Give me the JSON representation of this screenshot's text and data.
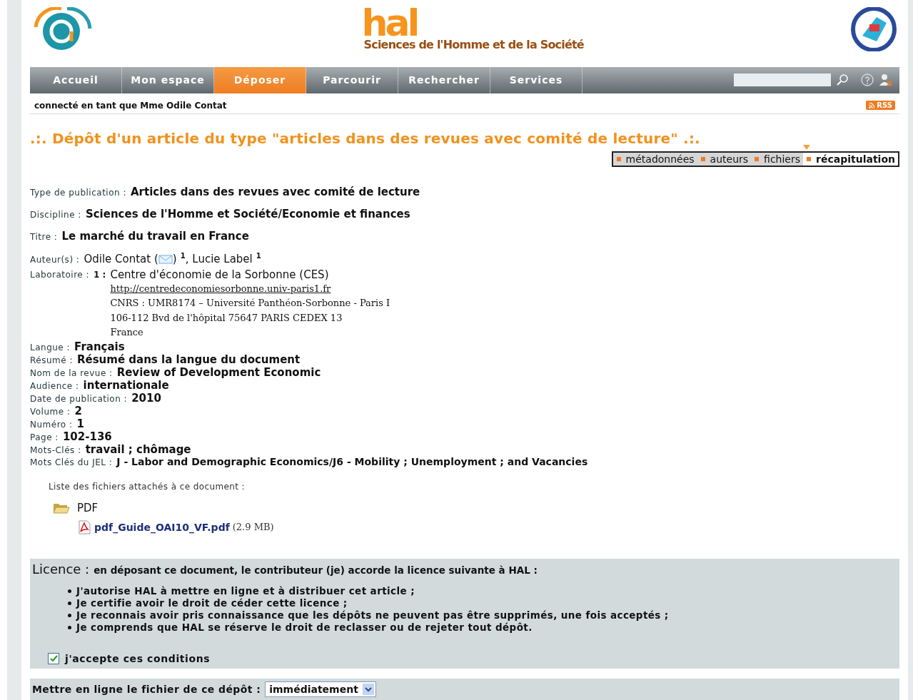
{
  "header": {
    "logo_word": "hal",
    "subtitle": "Sciences de l'Homme et de la Société"
  },
  "nav": {
    "items": [
      {
        "label": "Accueil",
        "selected": false
      },
      {
        "label": "Mon espace",
        "selected": false
      },
      {
        "label": "Déposer",
        "selected": true
      },
      {
        "label": "Parcourir",
        "selected": false
      },
      {
        "label": "Rechercher",
        "selected": false
      },
      {
        "label": "Services",
        "selected": false
      }
    ]
  },
  "login": "connecté en tant que Mme Odile Contat",
  "rss": "RSS",
  "title": ".:. Dépôt d'un article du type \"articles dans des revues avec comité de lecture\" .:.",
  "steps": [
    {
      "label": "métadonnées",
      "selected": false
    },
    {
      "label": "auteurs",
      "selected": false
    },
    {
      "label": "fichiers",
      "selected": false
    },
    {
      "label": "récapitulation",
      "selected": true
    }
  ],
  "main_fields": [
    {
      "label": "Type de publication :",
      "value": "Articles dans des revues avec comité de lecture"
    },
    {
      "label": "Discipline :",
      "value": "Sciences de l'Homme et Société/Economie et finances"
    },
    {
      "label": "Titre :",
      "value": "Le marché du travail en France"
    }
  ],
  "authors": {
    "label": "Auteur(s) :",
    "items": [
      {
        "text": "Odile Contat (",
        "email": true,
        "after": ")",
        "affiliation": "1"
      },
      {
        "text": ", Lucie Label",
        "email": false,
        "affiliation": "1"
      }
    ]
  },
  "laboratory": {
    "label": "Laboratoire :",
    "number": "1 :",
    "name": "Centre d'économie de la Sorbonne (CES)",
    "url": "http://centredeconomiesorbonne.univ-paris1.fr",
    "lines": [
      "CNRS : UMR8174 – Université Panthéon-Sorbonne - Paris I",
      "106-112 Bvd de l'hôpital 75647 PARIS CEDEX 13",
      "France"
    ]
  },
  "fields": [
    {
      "label": "Langue :",
      "value": "Français"
    },
    {
      "label": "Résumé :",
      "value": "Résumé dans la langue du document"
    },
    {
      "label": "Nom de la revue :",
      "value": "Review of Development Economic"
    },
    {
      "label": "Audience :",
      "value": "internationale"
    },
    {
      "label": "Date de publication :",
      "value": "2010"
    },
    {
      "label": "Volume :",
      "value": "2"
    },
    {
      "label": "Numéro :",
      "value": "1"
    },
    {
      "label": "Page :",
      "value": "102-136"
    },
    {
      "label": "Mots-Clés :",
      "value": "travail ; chômage"
    },
    {
      "label": "Mots Clés du JEL :",
      "value": "J - Labor and Demographic Economics/J6 - Mobility ; Unemployment ; and Vacancies"
    }
  ],
  "files": {
    "caption": "Liste des fichiers attachés à ce document :",
    "folder": "PDF",
    "file": {
      "name": "pdf_Guide_OAI10_VF.pdf",
      "size": "(2.9 MB)"
    }
  },
  "licence": {
    "title": "Licence :",
    "intro": "en déposant ce document, le contributeur (je) accorde la licence suivante à HAL :",
    "bullets": [
      "J'autorise HAL à mettre en ligne et à distribuer cet article ;",
      "Je certifie avoir le droit de céder cette licence ;",
      "Je reconnais avoir pris connaissance que les dépôts ne peuvent pas être supprimés, une fois acceptés ;",
      "Je comprends que HAL se réserve le droit de reclasser ou de rejeter tout dépôt."
    ],
    "accept": {
      "label": "j'accepte ces conditions",
      "checked": true
    }
  },
  "publish": {
    "label": "Mettre en ligne le fichier de ce dépôt :",
    "value": "immédiatement"
  }
}
